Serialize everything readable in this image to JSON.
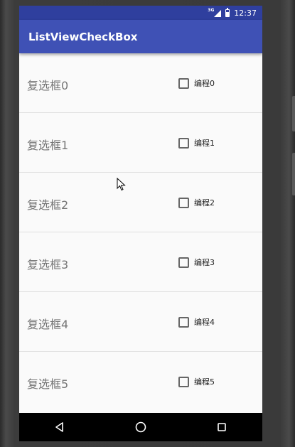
{
  "status_bar": {
    "network_label": "3G",
    "time": "12:37",
    "color": "#2f3f9e"
  },
  "app_bar": {
    "title": "ListViewCheckBox",
    "color": "#3f51b5"
  },
  "list": {
    "items": [
      {
        "label": "复选框0",
        "checkbox_label": "编程0",
        "checked": false
      },
      {
        "label": "复选框1",
        "checkbox_label": "编程1",
        "checked": false
      },
      {
        "label": "复选框2",
        "checkbox_label": "编程2",
        "checked": false
      },
      {
        "label": "复选框3",
        "checkbox_label": "编程3",
        "checked": false
      },
      {
        "label": "复选框4",
        "checkbox_label": "编程4",
        "checked": false
      },
      {
        "label": "复选框5",
        "checkbox_label": "编程5",
        "checked": false
      }
    ]
  },
  "nav_bar": {
    "back_icon": "back-triangle-icon",
    "home_icon": "home-circle-icon",
    "recents_icon": "recents-square-icon"
  }
}
